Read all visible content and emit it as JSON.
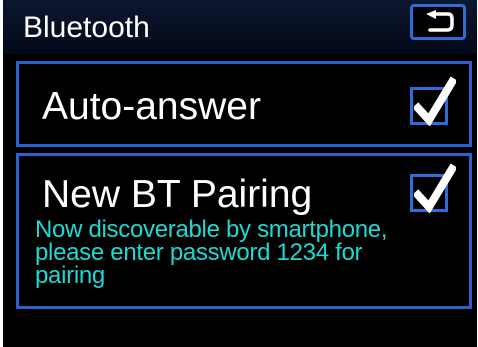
{
  "header": {
    "title": "Bluetooth",
    "back_icon": "back-arrow-icon"
  },
  "settings": [
    {
      "label": "Auto-answer",
      "checked": true,
      "check_icon": "checkmark-icon"
    },
    {
      "label": "New BT Pairing",
      "checked": true,
      "check_icon": "checkmark-icon",
      "description_lines": [
        "Now discoverable by smartphone,",
        "please enter password 1234 for",
        "pairing"
      ]
    }
  ],
  "colors": {
    "background": "#000000",
    "accent_border": "#2a63d1",
    "text": "#ffffff",
    "info_text": "#1fd8d2"
  }
}
